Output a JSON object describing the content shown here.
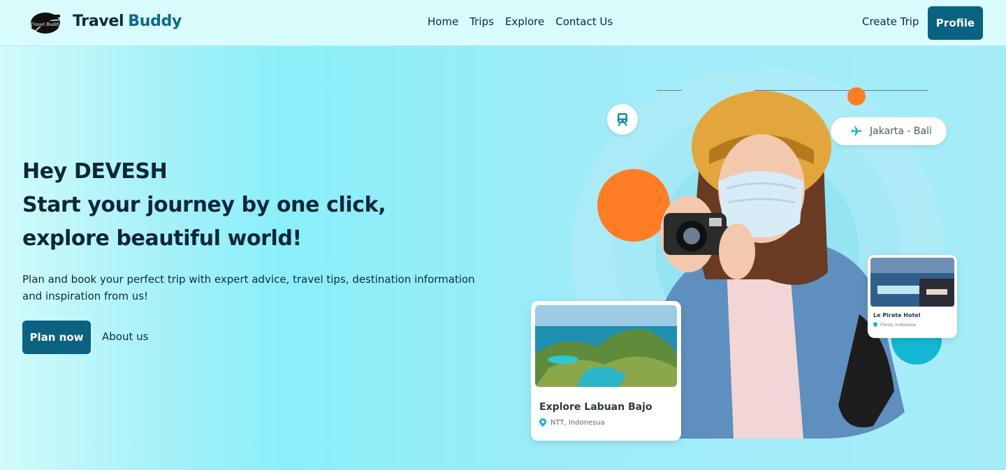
{
  "navbar": {
    "brand_part1": "Travel",
    "brand_part2": "Buddy",
    "logo_icon": "travel-buddy-logo",
    "links": [
      "Home",
      "Trips",
      "Explore",
      "Contact Us"
    ],
    "create_trip": "Create Trip",
    "profile": "Profile"
  },
  "hero": {
    "greeting": "Hey DEVESH",
    "headline_line2": "Start your journey by one click,",
    "headline_line3": "explore beautiful world!",
    "description": "Plan and book your perfect trip with expert advice, travel tips, destination information and inspiration from us!",
    "cta_primary": "Plan now",
    "cta_secondary": "About us"
  },
  "illustration": {
    "route_label": "Jakarta - Bali",
    "route_icon": "airplane-icon",
    "train_icon": "train-icon",
    "card_main": {
      "title": "Explore Labuan Bajo",
      "location": "NTT, Indonesua"
    },
    "card_hotel": {
      "title": "Le Pirate Hotel",
      "location": "Flores, Indonesia"
    }
  },
  "colors": {
    "primary": "#0b6180",
    "accent_orange": "#ff7d24",
    "teal": "#12b8d4",
    "navbar_bg": "#d9fcfd"
  }
}
